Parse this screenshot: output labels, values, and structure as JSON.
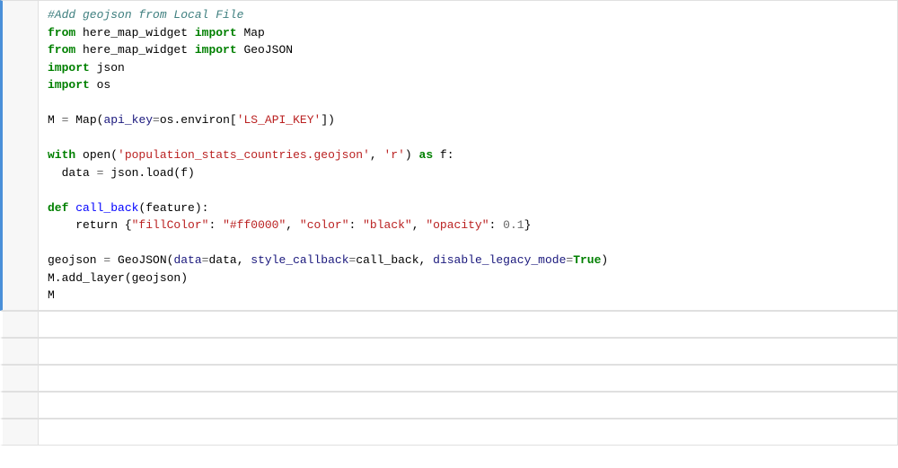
{
  "cells": [
    {
      "id": "cell-1",
      "type": "code",
      "active": true,
      "gutter": "",
      "lines": [
        {
          "tokens": [
            {
              "text": "#Add geojson from Local File",
              "class": "c-comment"
            }
          ]
        },
        {
          "tokens": [
            {
              "text": "from",
              "class": "c-keyword"
            },
            {
              "text": " here_map_widget ",
              "class": "c-plain"
            },
            {
              "text": "import",
              "class": "c-keyword"
            },
            {
              "text": " Map",
              "class": "c-plain"
            }
          ]
        },
        {
          "tokens": [
            {
              "text": "from",
              "class": "c-keyword"
            },
            {
              "text": " here_map_widget ",
              "class": "c-plain"
            },
            {
              "text": "import",
              "class": "c-keyword"
            },
            {
              "text": " GeoJSON",
              "class": "c-plain"
            }
          ]
        },
        {
          "tokens": [
            {
              "text": "import",
              "class": "c-keyword"
            },
            {
              "text": " json",
              "class": "c-plain"
            }
          ]
        },
        {
          "tokens": [
            {
              "text": "import",
              "class": "c-keyword"
            },
            {
              "text": " os",
              "class": "c-plain"
            }
          ]
        },
        {
          "tokens": []
        },
        {
          "tokens": [
            {
              "text": "M ",
              "class": "c-plain"
            },
            {
              "text": "=",
              "class": "c-operator"
            },
            {
              "text": " Map(",
              "class": "c-plain"
            },
            {
              "text": "api_key",
              "class": "c-param-name"
            },
            {
              "text": "=",
              "class": "c-operator"
            },
            {
              "text": "os.environ[",
              "class": "c-plain"
            },
            {
              "text": "'LS_API_KEY'",
              "class": "c-string"
            },
            {
              "text": "])",
              "class": "c-plain"
            }
          ]
        },
        {
          "tokens": []
        },
        {
          "tokens": [
            {
              "text": "with",
              "class": "c-keyword"
            },
            {
              "text": " open(",
              "class": "c-plain"
            },
            {
              "text": "'population_stats_countries.geojson'",
              "class": "c-string"
            },
            {
              "text": ", ",
              "class": "c-plain"
            },
            {
              "text": "'r'",
              "class": "c-string"
            },
            {
              "text": ") ",
              "class": "c-plain"
            },
            {
              "text": "as",
              "class": "c-keyword"
            },
            {
              "text": " f:",
              "class": "c-plain"
            }
          ]
        },
        {
          "tokens": [
            {
              "text": "  data ",
              "class": "c-plain"
            },
            {
              "text": "=",
              "class": "c-operator"
            },
            {
              "text": " json.load(f)",
              "class": "c-plain"
            }
          ]
        },
        {
          "tokens": []
        },
        {
          "tokens": [
            {
              "text": "def",
              "class": "c-keyword"
            },
            {
              "text": " ",
              "class": "c-plain"
            },
            {
              "text": "call_back",
              "class": "c-function"
            },
            {
              "text": "(feature):",
              "class": "c-plain"
            }
          ]
        },
        {
          "tokens": [
            {
              "text": "    return {",
              "class": "c-plain"
            },
            {
              "text": "\"fillColor\"",
              "class": "c-string"
            },
            {
              "text": ": ",
              "class": "c-plain"
            },
            {
              "text": "\"#ff0000\"",
              "class": "c-string"
            },
            {
              "text": ", ",
              "class": "c-plain"
            },
            {
              "text": "\"color\"",
              "class": "c-string"
            },
            {
              "text": ": ",
              "class": "c-plain"
            },
            {
              "text": "\"black\"",
              "class": "c-string"
            },
            {
              "text": ", ",
              "class": "c-plain"
            },
            {
              "text": "\"opacity\"",
              "class": "c-string"
            },
            {
              "text": ": ",
              "class": "c-plain"
            },
            {
              "text": "0.1",
              "class": "c-number"
            },
            {
              "text": "}",
              "class": "c-plain"
            }
          ]
        },
        {
          "tokens": []
        },
        {
          "tokens": [
            {
              "text": "geojson ",
              "class": "c-plain"
            },
            {
              "text": "=",
              "class": "c-operator"
            },
            {
              "text": " GeoJSON(",
              "class": "c-plain"
            },
            {
              "text": "data",
              "class": "c-param-name"
            },
            {
              "text": "=",
              "class": "c-operator"
            },
            {
              "text": "data, ",
              "class": "c-plain"
            },
            {
              "text": "style_callback",
              "class": "c-param-name"
            },
            {
              "text": "=",
              "class": "c-operator"
            },
            {
              "text": "call_back, ",
              "class": "c-plain"
            },
            {
              "text": "disable_legacy_mode",
              "class": "c-param-name"
            },
            {
              "text": "=",
              "class": "c-operator"
            },
            {
              "text": "True",
              "class": "c-boolean"
            },
            {
              "text": ")",
              "class": "c-plain"
            }
          ]
        },
        {
          "tokens": [
            {
              "text": "M.add_layer(geojson)",
              "class": "c-plain"
            }
          ]
        },
        {
          "tokens": [
            {
              "text": "M",
              "class": "c-plain"
            }
          ]
        }
      ]
    },
    {
      "id": "cell-2",
      "type": "empty",
      "active": false,
      "gutter": "",
      "lines": []
    },
    {
      "id": "cell-3",
      "type": "empty",
      "active": false,
      "gutter": "",
      "lines": []
    },
    {
      "id": "cell-4",
      "type": "empty",
      "active": false,
      "gutter": "",
      "lines": []
    },
    {
      "id": "cell-5",
      "type": "empty",
      "active": false,
      "gutter": "",
      "lines": []
    },
    {
      "id": "cell-6",
      "type": "empty",
      "active": false,
      "gutter": "",
      "lines": []
    }
  ]
}
